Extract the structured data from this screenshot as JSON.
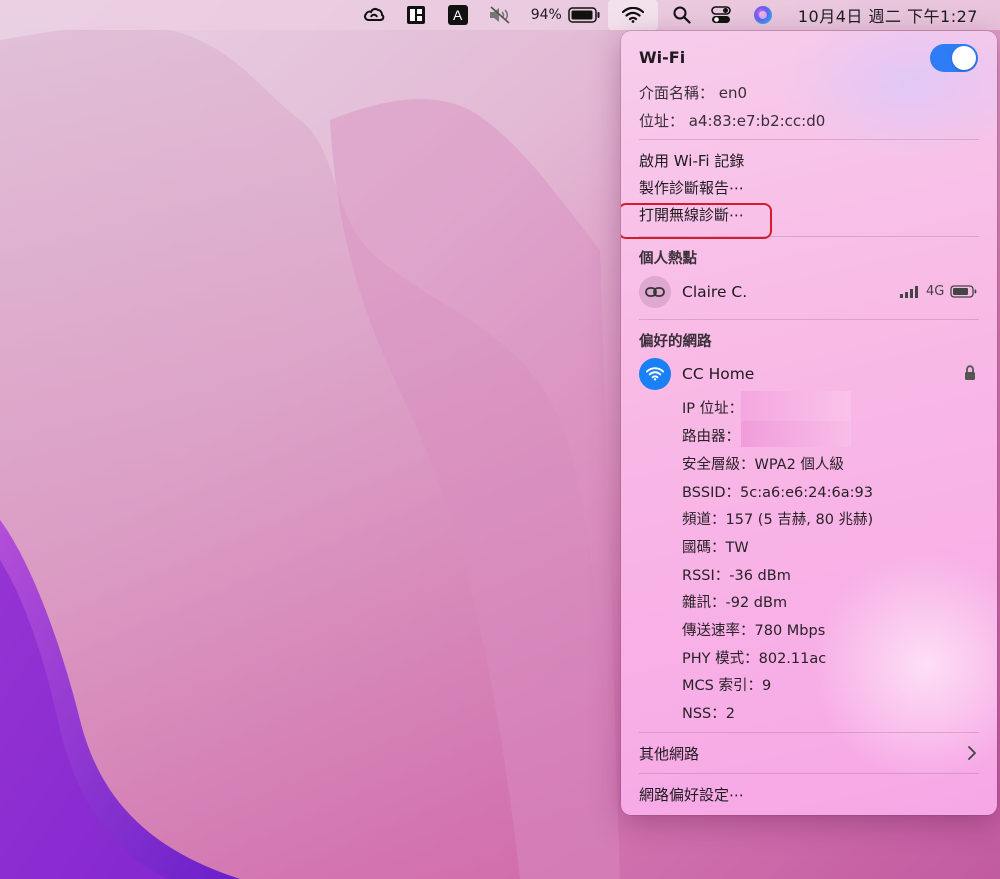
{
  "menubar": {
    "icons": [
      "creative-cloud-icon",
      "magnet-icon",
      "input-source-icon",
      "volume-muted-icon",
      "battery-icon",
      "wifi-icon",
      "spotlight-search-icon",
      "control-center-icon",
      "siri-icon"
    ],
    "input_source_letter": "A",
    "battery_percent": "94%",
    "clock": "10月4日 週二 下午1:27"
  },
  "panel": {
    "title": "Wi-Fi",
    "wifi_enabled": true,
    "toggle_color": "#2d7cf6",
    "interface_label": "介面名稱：",
    "interface_value": "en0",
    "address_label": "位址：",
    "address_value": "a4:83:e7:b2:cc:d0",
    "actions": {
      "enable_logging": "啟用 Wi-Fi 記錄",
      "create_report": "製作診斷報告⋯",
      "open_diagnostics": "打開無線診斷⋯"
    },
    "highlight_color": "#d41d2c",
    "hotspot_section": "個人熱點",
    "hotspot": {
      "name": "Claire C.",
      "network_type": "4G"
    },
    "preferred_section": "偏好的網路",
    "network": {
      "name": "CC Home",
      "icon_color": "#1a80f5",
      "details": [
        {
          "label": "IP 位址：",
          "value": ""
        },
        {
          "label": "路由器：",
          "value": ""
        },
        {
          "label": "安全層級：",
          "value": "WPA2 個人級"
        },
        {
          "label": "BSSID：",
          "value": "5c:a6:e6:24:6a:93"
        },
        {
          "label": "頻道：",
          "value": "157 (5 吉赫, 80 兆赫)"
        },
        {
          "label": "國碼：",
          "value": "TW"
        },
        {
          "label": "RSSI：",
          "value": "-36 dBm"
        },
        {
          "label": "雜訊：",
          "value": "-92 dBm"
        },
        {
          "label": "傳送速率：",
          "value": "780 Mbps"
        },
        {
          "label": "PHY 模式：",
          "value": "802.11ac"
        },
        {
          "label": "MCS 索引：",
          "value": "9"
        },
        {
          "label": "NSS：",
          "value": "2"
        }
      ]
    },
    "other_networks": "其他網路",
    "network_preferences": "網路偏好設定⋯"
  }
}
